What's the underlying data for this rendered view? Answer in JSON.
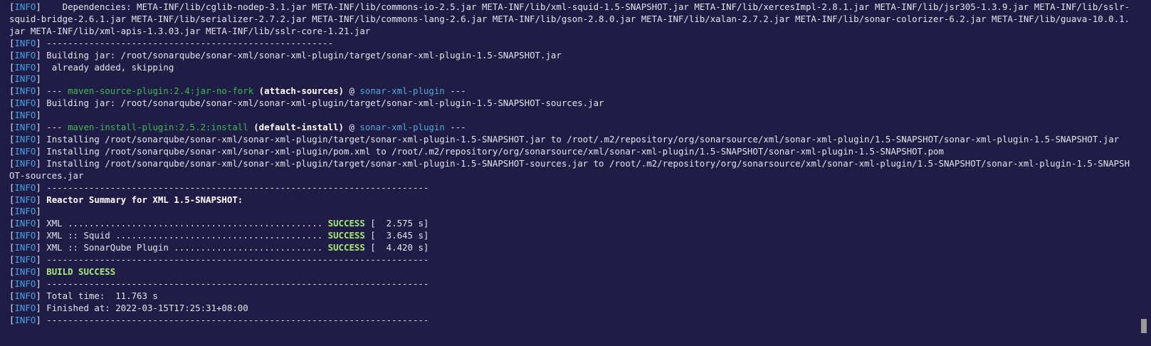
{
  "tag_label": "INFO",
  "lines": [
    {
      "kind": "plain",
      "text": "    Dependencies: META-INF/lib/cglib-nodep-3.1.jar META-INF/lib/commons-io-2.5.jar META-INF/lib/xml-squid-1.5-SNAPSHOT.jar META-INF/lib/xercesImpl-2.8.1.jar META-INF/lib/jsr305-1.3.9.jar META-INF/lib/sslr-squid-bridge-2.6.1.jar META-INF/lib/serializer-2.7.2.jar META-INF/lib/commons-lang-2.6.jar META-INF/lib/gson-2.8.0.jar META-INF/lib/xalan-2.7.2.jar META-INF/lib/sonar-colorizer-6.2.jar META-INF/lib/guava-10.0.1.jar META-INF/lib/xml-apis-1.3.03.jar META-INF/lib/sslr-core-1.21.jar"
    },
    {
      "kind": "plain",
      "text": " ------------------------------------------------------"
    },
    {
      "kind": "plain",
      "text": " Building jar: /root/sonarqube/sonar-xml/sonar-xml-plugin/target/sonar-xml-plugin-1.5-SNAPSHOT.jar"
    },
    {
      "kind": "plain",
      "text": "  already added, skipping"
    },
    {
      "kind": "plain",
      "text": ""
    },
    {
      "kind": "mojo",
      "prefix": " --- ",
      "plugin": "maven-source-plugin:2.4:jar-no-fork",
      "execution": "(attach-sources)",
      "at": " @ ",
      "artifact": "sonar-xml-plugin",
      "suffix": " ---"
    },
    {
      "kind": "plain",
      "text": " Building jar: /root/sonarqube/sonar-xml/sonar-xml-plugin/target/sonar-xml-plugin-1.5-SNAPSHOT-sources.jar"
    },
    {
      "kind": "plain",
      "text": ""
    },
    {
      "kind": "mojo",
      "prefix": " --- ",
      "plugin": "maven-install-plugin:2.5.2:install",
      "execution": "(default-install)",
      "at": " @ ",
      "artifact": "sonar-xml-plugin",
      "suffix": " ---"
    },
    {
      "kind": "plain",
      "text": " Installing /root/sonarqube/sonar-xml/sonar-xml-plugin/target/sonar-xml-plugin-1.5-SNAPSHOT.jar to /root/.m2/repository/org/sonarsource/xml/sonar-xml-plugin/1.5-SNAPSHOT/sonar-xml-plugin-1.5-SNAPSHOT.jar"
    },
    {
      "kind": "plain",
      "text": " Installing /root/sonarqube/sonar-xml/sonar-xml-plugin/pom.xml to /root/.m2/repository/org/sonarsource/xml/sonar-xml-plugin/1.5-SNAPSHOT/sonar-xml-plugin-1.5-SNAPSHOT.pom"
    },
    {
      "kind": "plain",
      "text": " Installing /root/sonarqube/sonar-xml/sonar-xml-plugin/target/sonar-xml-plugin-1.5-SNAPSHOT-sources.jar to /root/.m2/repository/org/sonarsource/xml/sonar-xml-plugin/1.5-SNAPSHOT/sonar-xml-plugin-1.5-SNAPSHOT-sources.jar"
    },
    {
      "kind": "plain",
      "text": " ------------------------------------------------------------------------"
    },
    {
      "kind": "bold",
      "text": " Reactor Summary for XML 1.5-SNAPSHOT:"
    },
    {
      "kind": "plain",
      "text": ""
    },
    {
      "kind": "module",
      "name": " XML ................................................ ",
      "status": "SUCCESS",
      "time": " [  2.575 s]"
    },
    {
      "kind": "module",
      "name": " XML :: Squid ....................................... ",
      "status": "SUCCESS",
      "time": " [  3.645 s]"
    },
    {
      "kind": "module",
      "name": " XML :: SonarQube Plugin ............................ ",
      "status": "SUCCESS",
      "time": " [  4.420 s]"
    },
    {
      "kind": "plain",
      "text": " ------------------------------------------------------------------------"
    },
    {
      "kind": "success",
      "prefix": " ",
      "text": "BUILD SUCCESS"
    },
    {
      "kind": "plain",
      "text": " ------------------------------------------------------------------------"
    },
    {
      "kind": "plain",
      "text": " Total time:  11.763 s"
    },
    {
      "kind": "plain",
      "text": " Finished at: 2022-03-15T17:25:31+08:00"
    },
    {
      "kind": "plain",
      "text": " ------------------------------------------------------------------------"
    }
  ]
}
